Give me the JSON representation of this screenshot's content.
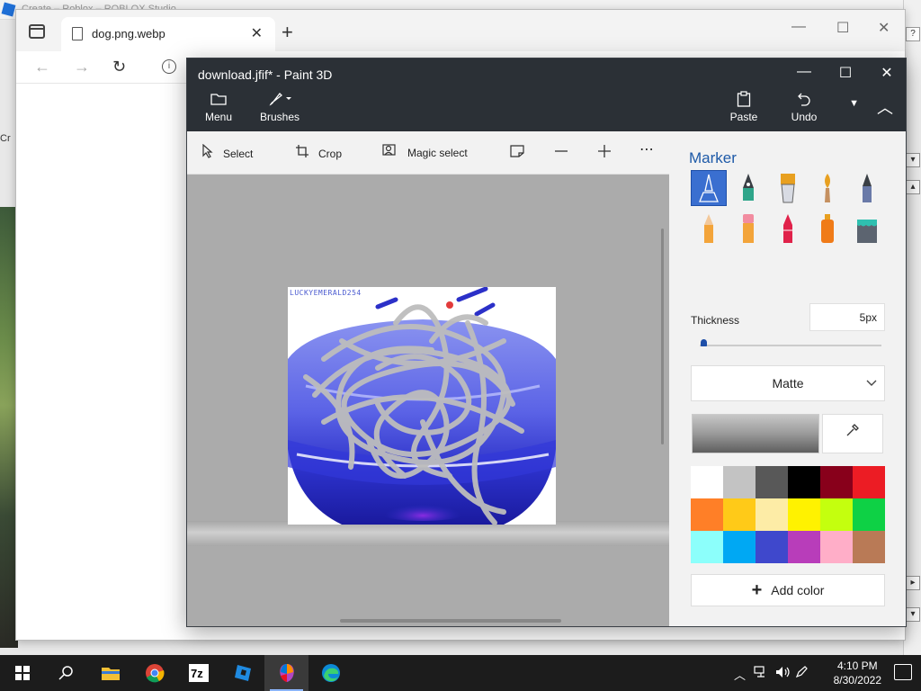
{
  "desktop": {
    "background_window_title": "Create – Roblox – ROBLOX Studio",
    "left_snippet": "Cr"
  },
  "browser": {
    "tab_title": "dog.png.webp",
    "tab_close": "✕",
    "new_tab": "+"
  },
  "paint": {
    "window_title": "download.jfif* - Paint 3D",
    "header_buttons": {
      "menu": "Menu",
      "brushes": "Brushes",
      "paste": "Paste",
      "undo": "Undo"
    },
    "toolbar": {
      "select": "Select",
      "crop": "Crop",
      "magic_select": "Magic select",
      "more": "⋯"
    },
    "canvas": {
      "watermark": "LUCKYEMERALD254"
    },
    "panel": {
      "title": "Marker",
      "tools": [
        "marker",
        "calligraphy-pen",
        "oil-brush",
        "watercolor",
        "pixel-pen",
        "pencil",
        "eraser",
        "crayon",
        "spray-can",
        "fill"
      ],
      "selected_tool": "marker",
      "thickness_label": "Thickness",
      "thickness_value": "5px",
      "thickness_level": 0.02,
      "finish": "Matte",
      "palette": [
        "#ffffff",
        "#c3c3c3",
        "#585858",
        "#000000",
        "#88001b",
        "#ec1c24",
        "#ff7f27",
        "#ffca18",
        "#fdeca6",
        "#fff200",
        "#c4ff0e",
        "#0ed145",
        "#8cfffb",
        "#00a8f3",
        "#3f48cc",
        "#b83dba",
        "#ffaec8",
        "#b97a56"
      ],
      "add_color": "Add color"
    }
  },
  "taskbar": {
    "time": "4:10 PM",
    "date": "8/30/2022",
    "apps": [
      "search",
      "file-explorer",
      "chrome",
      "7zip",
      "roblox-studio",
      "paint-3d",
      "edge"
    ],
    "active_app": "paint-3d"
  }
}
